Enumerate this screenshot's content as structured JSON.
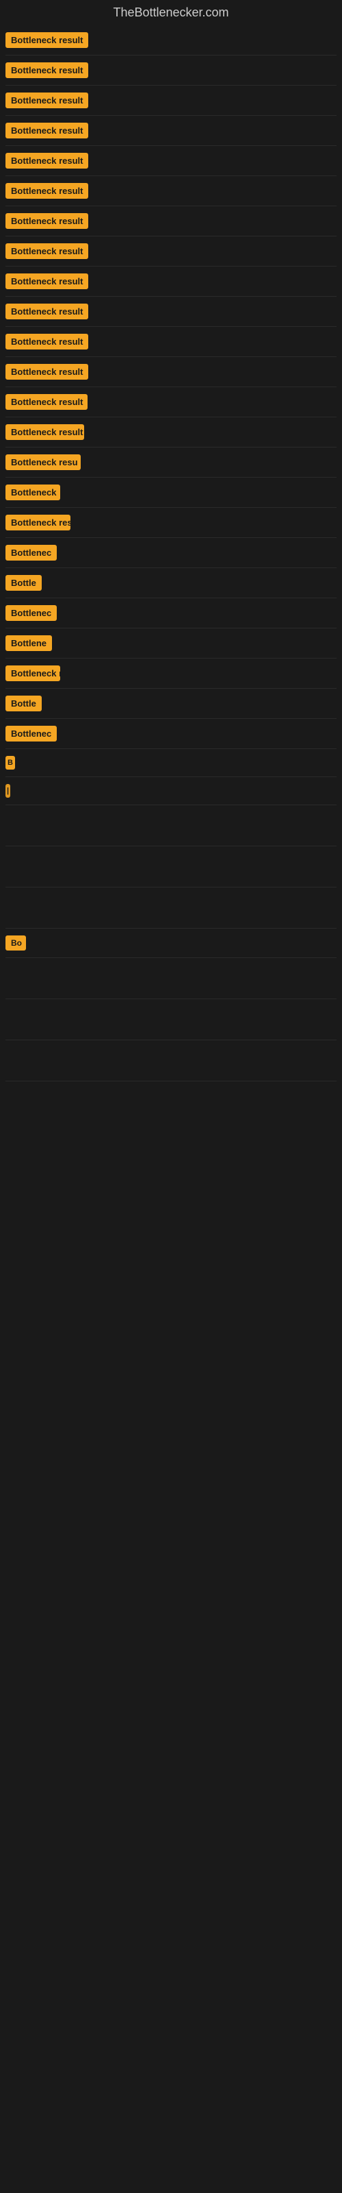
{
  "site": {
    "title": "TheBottlenecker.com"
  },
  "rows": [
    {
      "id": 1,
      "label": "Bottleneck result",
      "visible": true
    },
    {
      "id": 2,
      "label": "Bottleneck result",
      "visible": true
    },
    {
      "id": 3,
      "label": "Bottleneck result",
      "visible": true
    },
    {
      "id": 4,
      "label": "Bottleneck result",
      "visible": true
    },
    {
      "id": 5,
      "label": "Bottleneck result",
      "visible": true
    },
    {
      "id": 6,
      "label": "Bottleneck result",
      "visible": true
    },
    {
      "id": 7,
      "label": "Bottleneck result",
      "visible": true
    },
    {
      "id": 8,
      "label": "Bottleneck result",
      "visible": true
    },
    {
      "id": 9,
      "label": "Bottleneck result",
      "visible": true
    },
    {
      "id": 10,
      "label": "Bottleneck result",
      "visible": true
    },
    {
      "id": 11,
      "label": "Bottleneck result",
      "visible": true
    },
    {
      "id": 12,
      "label": "Bottleneck result",
      "visible": true
    },
    {
      "id": 13,
      "label": "Bottleneck result",
      "visible": true
    },
    {
      "id": 14,
      "label": "Bottleneck result",
      "visible": true
    },
    {
      "id": 15,
      "label": "Bottleneck resu",
      "visible": true
    },
    {
      "id": 16,
      "label": "Bottleneck",
      "visible": true
    },
    {
      "id": 17,
      "label": "Bottleneck res",
      "visible": true
    },
    {
      "id": 18,
      "label": "Bottlenec",
      "visible": true
    },
    {
      "id": 19,
      "label": "Bottle",
      "visible": true
    },
    {
      "id": 20,
      "label": "Bottlenec",
      "visible": true
    },
    {
      "id": 21,
      "label": "Bottlene",
      "visible": true
    },
    {
      "id": 22,
      "label": "Bottleneck r",
      "visible": true
    },
    {
      "id": 23,
      "label": "Bottle",
      "visible": true
    },
    {
      "id": 24,
      "label": "Bottlenec",
      "visible": true
    },
    {
      "id": 25,
      "label": "B",
      "visible": true
    },
    {
      "id": 26,
      "label": "|",
      "visible": true
    },
    {
      "id": 27,
      "label": "",
      "visible": false
    },
    {
      "id": 28,
      "label": "",
      "visible": false
    },
    {
      "id": 29,
      "label": "",
      "visible": false
    },
    {
      "id": 30,
      "label": "Bo",
      "visible": true
    },
    {
      "id": 31,
      "label": "",
      "visible": false
    },
    {
      "id": 32,
      "label": "",
      "visible": false
    },
    {
      "id": 33,
      "label": "",
      "visible": false
    }
  ]
}
